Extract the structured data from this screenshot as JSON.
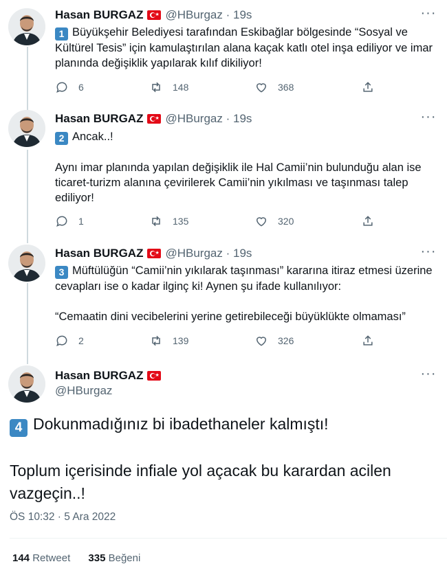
{
  "author": {
    "name": "Hasan BURGAZ",
    "handle": "@HBurgaz",
    "flag_icon": "turkey-flag",
    "avatar_icon": "profile-photo-man-suit"
  },
  "tweets": [
    {
      "number": "1",
      "time": "19s",
      "dot": "·",
      "paragraphs": [
        "Büyükşehir Belediyesi tarafından Eskibağlar bölgesinde “Sosyal ve Kültürel Tesis” için kamulaştırılan alana kaçak katlı otel inşa ediliyor ve imar planında değişiklik yapılarak kılıf dikiliyor!"
      ],
      "replies": "6",
      "retweets": "148",
      "likes": "368"
    },
    {
      "number": "2",
      "time": "19s",
      "dot": "·",
      "paragraphs": [
        "Ancak..!",
        "Aynı imar planında yapılan değişiklik ile Hal Camii’nin bulunduğu alan ise ticaret-turizm alanına çevirilerek Camii’nin yıkılması ve taşınması talep ediliyor!"
      ],
      "replies": "1",
      "retweets": "135",
      "likes": "320"
    },
    {
      "number": "3",
      "time": "19s",
      "dot": "·",
      "paragraphs": [
        "Müftülüğün “Camii’nin yıkılarak taşınması” kararına itiraz etmesi üzerine cevapları ise o kadar ilginç ki! Aynen şu ifade kullanılıyor:",
        "“Cemaatin dini vecibelerini yerine getirebileceği büyüklükte olmaması”"
      ],
      "replies": "2",
      "retweets": "139",
      "likes": "326"
    }
  ],
  "main_tweet": {
    "number": "4",
    "paragraphs": [
      "Dokunmadığınız bi ibadethaneler kalmıştı!",
      "Toplum içerisinde infiale yol açacak bu karardan acilen vazgeçin..!"
    ],
    "timestamp": "ÖS 10:32 · 5 Ara 2022",
    "retweet_count": "144",
    "retweet_label": "Retweet",
    "like_count": "335",
    "like_label": "Beğeni"
  },
  "more_label": "···",
  "colors": {
    "text": "#0f1419",
    "secondary": "#536471",
    "keycap": "#3b88c3",
    "flag": "#e30a17",
    "thread_line": "#cfd9de"
  }
}
